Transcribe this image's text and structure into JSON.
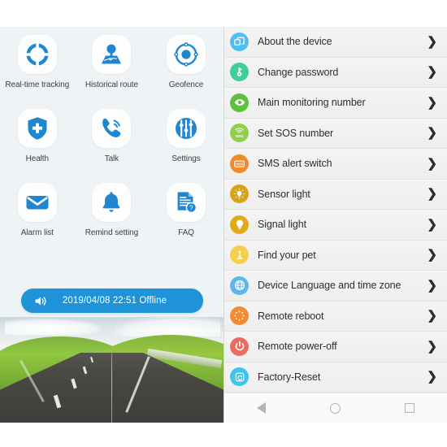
{
  "app": {
    "title": "GPS Tracker App",
    "panel_background": "#eef3f6",
    "accent_blue": "#1f93d9"
  },
  "left_panel": {
    "apps": [
      {
        "label": "Real-time tracking",
        "icon": "crosshair-target-icon",
        "color": "#1f87d0"
      },
      {
        "label": "Historical route",
        "icon": "map-pin-route-icon",
        "color": "#1f87d0"
      },
      {
        "label": "Geofence",
        "icon": "geofence-circle-icon",
        "color": "#1f87d0"
      },
      {
        "label": "Health",
        "icon": "shield-cross-icon",
        "color": "#1f87d0"
      },
      {
        "label": "Talk",
        "icon": "phone-call-icon",
        "color": "#1f87d0"
      },
      {
        "label": "Settings",
        "icon": "sliders-settings-icon",
        "color": "#1f87d0"
      },
      {
        "label": "Alarm list",
        "icon": "envelope-icon",
        "color": "#1f87d0"
      },
      {
        "label": "Remind setting",
        "icon": "bell-icon",
        "color": "#1f87d0"
      },
      {
        "label": "FAQ",
        "icon": "document-question-icon",
        "color": "#1f87d0"
      }
    ],
    "status_bar": {
      "icon": "speaker-sound-icon",
      "text": "2019/04/08 22:51 Offline",
      "background": "#1f93d9"
    }
  },
  "right_panel": {
    "menu_items": [
      {
        "label": "About the device",
        "icon": "layers-device-icon",
        "color": "#4ec0f0"
      },
      {
        "label": "Change password",
        "icon": "key-icon",
        "color": "#3fcf9a"
      },
      {
        "label": "Main monitoring number",
        "icon": "eye-icon",
        "color": "#5ec03c"
      },
      {
        "label": "Set SOS number",
        "icon": "sos-broadcast-icon",
        "color": "#8ed04a"
      },
      {
        "label": "SMS alert switch",
        "icon": "sos-message-icon",
        "color": "#f08a2c"
      },
      {
        "label": "Sensor light",
        "icon": "sensor-bulb-icon",
        "color": "#d8a413"
      },
      {
        "label": "Signal light",
        "icon": "bulb-icon",
        "color": "#e0ab15"
      },
      {
        "label": "Find your pet",
        "icon": "pet-locate-icon",
        "color": "#f7cf4f"
      },
      {
        "label": "Device Language and time zone",
        "icon": "globe-icon",
        "color": "#5bb8ea"
      },
      {
        "label": "Remote reboot",
        "icon": "reboot-spinner-icon",
        "color": "#f58a30"
      },
      {
        "label": "Remote power-off",
        "icon": "power-icon",
        "color": "#ec6a62"
      },
      {
        "label": "Factory-Reset",
        "icon": "factory-reset-icon",
        "color": "#3fc4ea"
      }
    ],
    "chevron": "❯"
  },
  "navbar": {
    "buttons": [
      {
        "name": "back",
        "icon": "triangle-back-icon"
      },
      {
        "name": "home",
        "icon": "circle-home-icon"
      },
      {
        "name": "recents",
        "icon": "square-recents-icon"
      }
    ]
  }
}
